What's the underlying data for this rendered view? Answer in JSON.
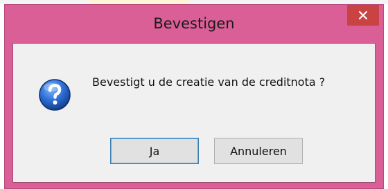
{
  "window": {
    "title": "Bevestigen",
    "close_symbol": "×",
    "accent_color": "#d95f96"
  },
  "dialog": {
    "icon": "question-icon",
    "message": "Bevestigt u de creatie van de creditnota ?",
    "buttons": {
      "yes_label": "Ja",
      "cancel_label": "Annuleren"
    }
  }
}
